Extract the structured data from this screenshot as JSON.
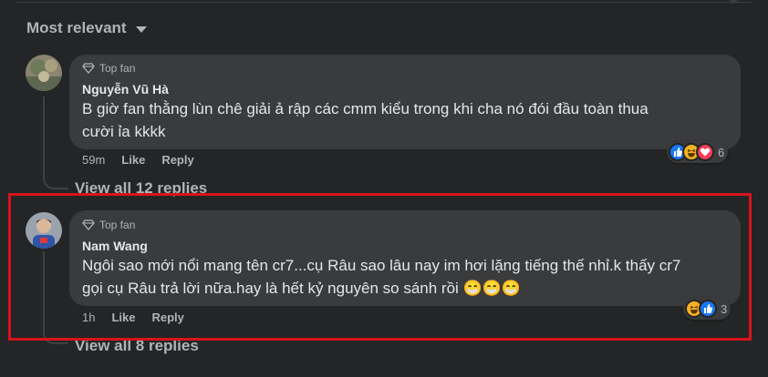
{
  "sort": {
    "label": "Most relevant"
  },
  "comments": [
    {
      "badge": "Top fan",
      "author": "Nguyễn Vũ Hà",
      "lines": [
        "B giờ fan thằng lùn chê giải ả rập các cmm kiểu trong khi cha nó đói đầu toàn thua",
        "cười ỉa kkkk"
      ],
      "time": "59m",
      "like_label": "Like",
      "reply_label": "Reply",
      "reactions": [
        "like",
        "haha",
        "love"
      ],
      "reaction_count": "6",
      "view_replies": "View all 12 replies"
    },
    {
      "badge": "Top fan",
      "author": "Nam Wang",
      "lines": [
        "Ngôi sao mới nổi mang tên cr7...cụ Râu sao lâu nay im hơi lặng tiếng thế nhỉ.k thấy cr7",
        "gọi cụ Râu trả lời nữa.hay là hết kỷ nguyên so sánh rồi 😁😁😁"
      ],
      "time": "1h",
      "like_label": "Like",
      "reply_label": "Reply",
      "reactions": [
        "haha",
        "like"
      ],
      "reaction_count": "3",
      "view_replies": "View all 8 replies"
    }
  ],
  "colors": {
    "background": "#242526",
    "bubble": "#3a3b3c",
    "highlight_border": "#d8141b",
    "like": "#1877f2",
    "haha": "#f7b125",
    "love": "#f33e58"
  }
}
